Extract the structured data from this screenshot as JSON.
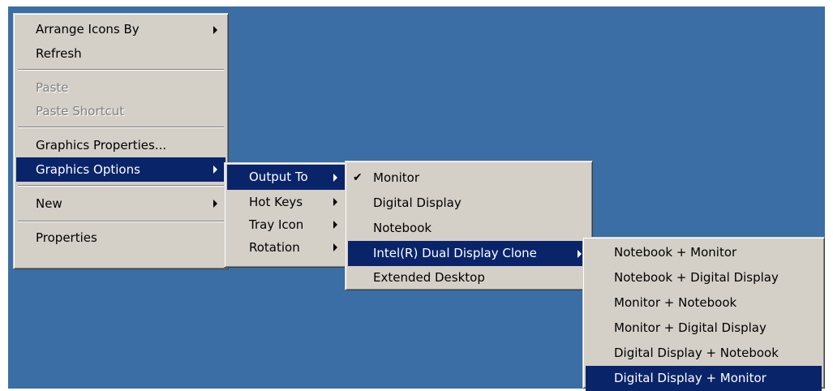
{
  "main_menu": {
    "arrange_icons_by": "Arrange Icons By",
    "refresh": "Refresh",
    "paste": "Paste",
    "paste_shortcut": "Paste Shortcut",
    "graphics_properties": "Graphics Properties...",
    "graphics_options": "Graphics Options",
    "new": "New",
    "properties": "Properties"
  },
  "graphics_options_menu": {
    "output_to": "Output To",
    "hot_keys": "Hot Keys",
    "tray_icon": "Tray Icon",
    "rotation": "Rotation"
  },
  "output_to_menu": {
    "checked_item": "Monitor",
    "monitor": "Monitor",
    "digital_display": "Digital Display",
    "notebook": "Notebook",
    "dual_display_clone": "Intel(R) Dual Display Clone",
    "extended_desktop": "Extended Desktop"
  },
  "clone_menu": {
    "items": [
      "Notebook + Monitor",
      "Notebook + Digital Display",
      "Monitor + Notebook",
      "Monitor + Digital Display",
      "Digital Display + Notebook",
      "Digital Display + Monitor"
    ],
    "selected": "Digital Display + Monitor"
  },
  "colors": {
    "desktop": "#3a6ea5",
    "menu_face": "#d4d0c8",
    "highlight": "#0a246a",
    "highlight_text": "#ffffff",
    "disabled_text": "#808080"
  }
}
